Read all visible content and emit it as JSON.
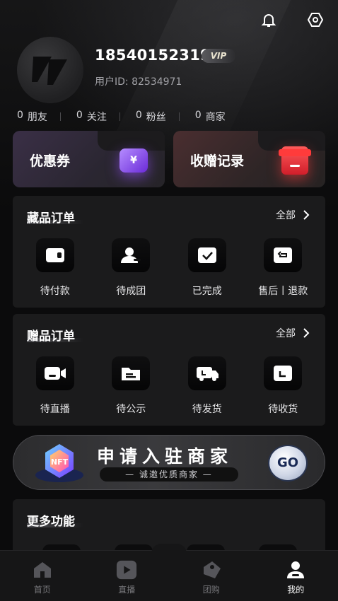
{
  "user": {
    "phone": "18540152319",
    "vip_label": "VIP",
    "uid_text": "用户ID: 82534971"
  },
  "stats": [
    {
      "count": "0",
      "label": "朋友"
    },
    {
      "count": "0",
      "label": "关注"
    },
    {
      "count": "0",
      "label": "粉丝"
    },
    {
      "count": "0",
      "label": "商家"
    }
  ],
  "promos": {
    "coupon_label": "优惠券",
    "coupon_icon_glyph": "¥",
    "gift_label": "收赠记录"
  },
  "collection_orders": {
    "title": "藏品订单",
    "more": "全部",
    "items": [
      {
        "label": "待付款",
        "icon": "wallet-icon"
      },
      {
        "label": "待成团",
        "icon": "group-icon"
      },
      {
        "label": "已完成",
        "icon": "box-check-icon"
      },
      {
        "label": "售后丨退款",
        "icon": "return-box-icon"
      }
    ]
  },
  "gift_orders": {
    "title": "赠品订单",
    "more": "全部",
    "items": [
      {
        "label": "待直播",
        "icon": "camera-icon"
      },
      {
        "label": "待公示",
        "icon": "folder-icon"
      },
      {
        "label": "待发货",
        "icon": "truck-icon"
      },
      {
        "label": "待收货",
        "icon": "package-icon"
      }
    ]
  },
  "banner": {
    "title": "申请入驻商家",
    "subtitle": "— 诚邀优质商家 —",
    "go_label": "GO",
    "emblem_text": "NFT"
  },
  "more_functions": {
    "title": "更多功能"
  },
  "tabbar": [
    {
      "label": "首页",
      "icon": "home-icon",
      "active": false
    },
    {
      "label": "直播",
      "icon": "play-icon",
      "active": false
    },
    {
      "label": "团购",
      "icon": "tag-icon",
      "active": false
    },
    {
      "label": "我的",
      "icon": "user-icon",
      "active": true
    }
  ],
  "colors": {
    "background": "#0b0b0c",
    "card": "#1b1b1c",
    "coupon_accent": "#8a4dff",
    "gift_accent": "#ff3b3b"
  }
}
